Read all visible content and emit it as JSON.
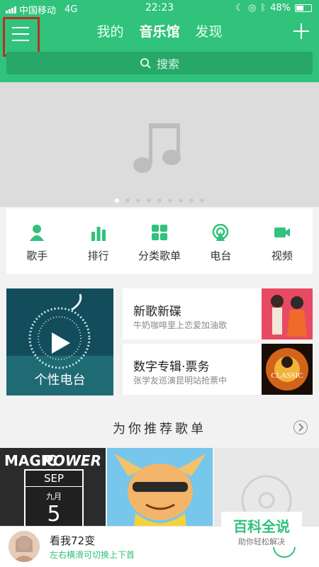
{
  "status_bar": {
    "carrier": "中国移动",
    "network": "4G",
    "time": "22:23",
    "battery": "48%",
    "battery_level": 0.48
  },
  "header": {
    "tabs": [
      {
        "label": "我的",
        "active": false
      },
      {
        "label": "音乐馆",
        "active": true
      },
      {
        "label": "发现",
        "active": false
      }
    ],
    "search_placeholder": "搜索",
    "icons": {
      "menu": "menu-icon",
      "add": "plus-icon",
      "search": "search-icon"
    },
    "accent_color": "#31c27c"
  },
  "banner": {
    "icon": "music-note-icon",
    "page_count": 9,
    "active_page": 0
  },
  "categories": [
    {
      "label": "歌手",
      "icon": "singer-icon"
    },
    {
      "label": "排行",
      "icon": "ranking-icon"
    },
    {
      "label": "分类歌单",
      "icon": "category-icon"
    },
    {
      "label": "电台",
      "icon": "radio-icon"
    },
    {
      "label": "视频",
      "icon": "video-icon"
    }
  ],
  "personal_radio": {
    "label": "个性电台",
    "icon": "play-icon"
  },
  "feature_tiles": [
    {
      "title": "新歌新碟",
      "subtitle": "牛奶咖啡里上恋爱加油歌"
    },
    {
      "title": "数字专辑·票务",
      "subtitle": "张学友巡演昆明站抢票中",
      "cover_text": "CLASSIC"
    }
  ],
  "recommend": {
    "title": "为你推荐歌单",
    "playlists": [
      {
        "text_top_left": "MAGIC",
        "text_top_right": "POWER",
        "month": "SEP",
        "month_cn": "九月",
        "day": "5"
      },
      {
        "art": "cartoon-character"
      },
      {
        "art": "disc-icon"
      }
    ]
  },
  "player": {
    "song": "看我72变",
    "hint": "左右横滑可切换上下首"
  },
  "watermark": {
    "title": "百科全说",
    "subtitle": "助你轻松解决"
  }
}
